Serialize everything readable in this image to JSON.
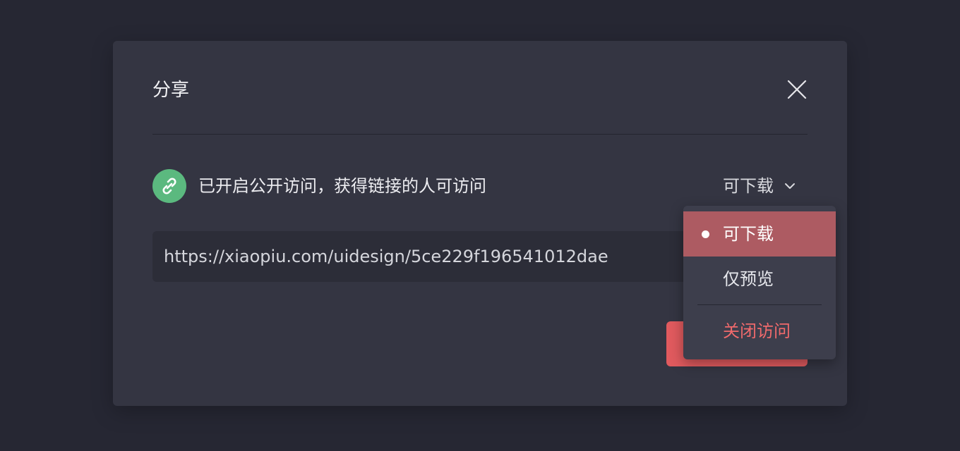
{
  "dialog": {
    "title": "分享",
    "access_text": "已开启公开访问，获得链接的人可访问",
    "permission_selected": "可下载",
    "share_url": "https://xiaopiu.com/uidesign/5ce229f196541012dae"
  },
  "dropdown": {
    "items": [
      {
        "label": "可下载",
        "selected": true
      },
      {
        "label": "仅预览",
        "selected": false
      }
    ],
    "danger_item": "关闭访问"
  },
  "icons": {
    "close": "close-icon",
    "link": "link-icon",
    "chevron": "chevron-down-icon",
    "bullet": "selected-bullet-icon"
  },
  "colors": {
    "background": "#262733",
    "dialog": "#343542",
    "accent_green": "#5bb97f",
    "primary_red": "#e05a5e",
    "selected_item": "#ad5b62",
    "danger_text": "#f06a6c"
  }
}
